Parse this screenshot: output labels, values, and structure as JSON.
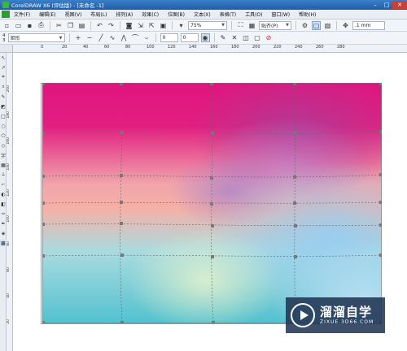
{
  "window": {
    "title": "CorelDRAW X6 (评估版) - [未命名 -1]"
  },
  "menu": [
    "文件(F)",
    "编辑(E)",
    "视图(V)",
    "布局(L)",
    "排列(A)",
    "效果(C)",
    "位图(B)",
    "文本(X)",
    "表格(T)",
    "工具(O)",
    "窗口(W)",
    "帮助(H)"
  ],
  "toolbar": {
    "zoom": "75%",
    "snap": "贴齐(P)",
    "nudge": ".1 mm"
  },
  "property_bar": {
    "shape": "矩形",
    "size_top": "4",
    "size_bottom": "3",
    "spin1": "0",
    "spin2": "0"
  },
  "ruler": {
    "h_ticks": [
      "0",
      "20",
      "40",
      "60",
      "80",
      "100",
      "120",
      "140",
      "160",
      "180",
      "200",
      "220",
      "240",
      "260",
      "280"
    ],
    "v_ticks": [
      "200",
      "180",
      "160",
      "140",
      "120",
      "100",
      "80",
      "60",
      "40",
      "20"
    ]
  },
  "mesh": {
    "columns": 4,
    "rows": 5,
    "colors": {
      "magenta": "#e0147f",
      "purple": "#a93c96",
      "pink": "#f6b0a6",
      "sky": "#96cdf0",
      "teal": "#52c1cf",
      "pale_green": "#e1f0cd"
    }
  },
  "watermark": {
    "brand": "溜溜自学",
    "url": "ZIXUE.3D66.COM"
  }
}
